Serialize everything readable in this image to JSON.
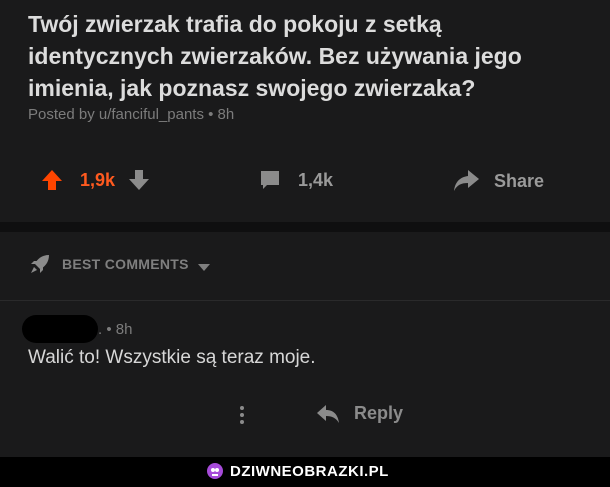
{
  "post": {
    "title": "Twój zwierzak trafia do pokoju z setką identycznych zwierzaków. Bez używania jego imienia, jak poznasz swojego zwierzaka?",
    "meta": "Posted by u/fanciful_pants • 8h"
  },
  "actions": {
    "score": "1,9k",
    "comments": "1,4k",
    "share": "Share",
    "upvote_color": "#ff4500"
  },
  "sort": {
    "label": "BEST COMMENTS"
  },
  "comment": {
    "meta": ". • 8h",
    "body": "Walić to! Wszystkie są teraz moje.",
    "reply": "Reply"
  },
  "footer": {
    "watermark": "DZIWNEOBRAZKI.PL",
    "logo_color": "#a64bd9"
  },
  "icons": [
    "upvote-icon",
    "downvote-icon",
    "comment-icon",
    "share-icon",
    "rocket-icon",
    "chevron-down-icon",
    "more-vertical-icon",
    "reply-icon",
    "watermark-logo-icon"
  ]
}
